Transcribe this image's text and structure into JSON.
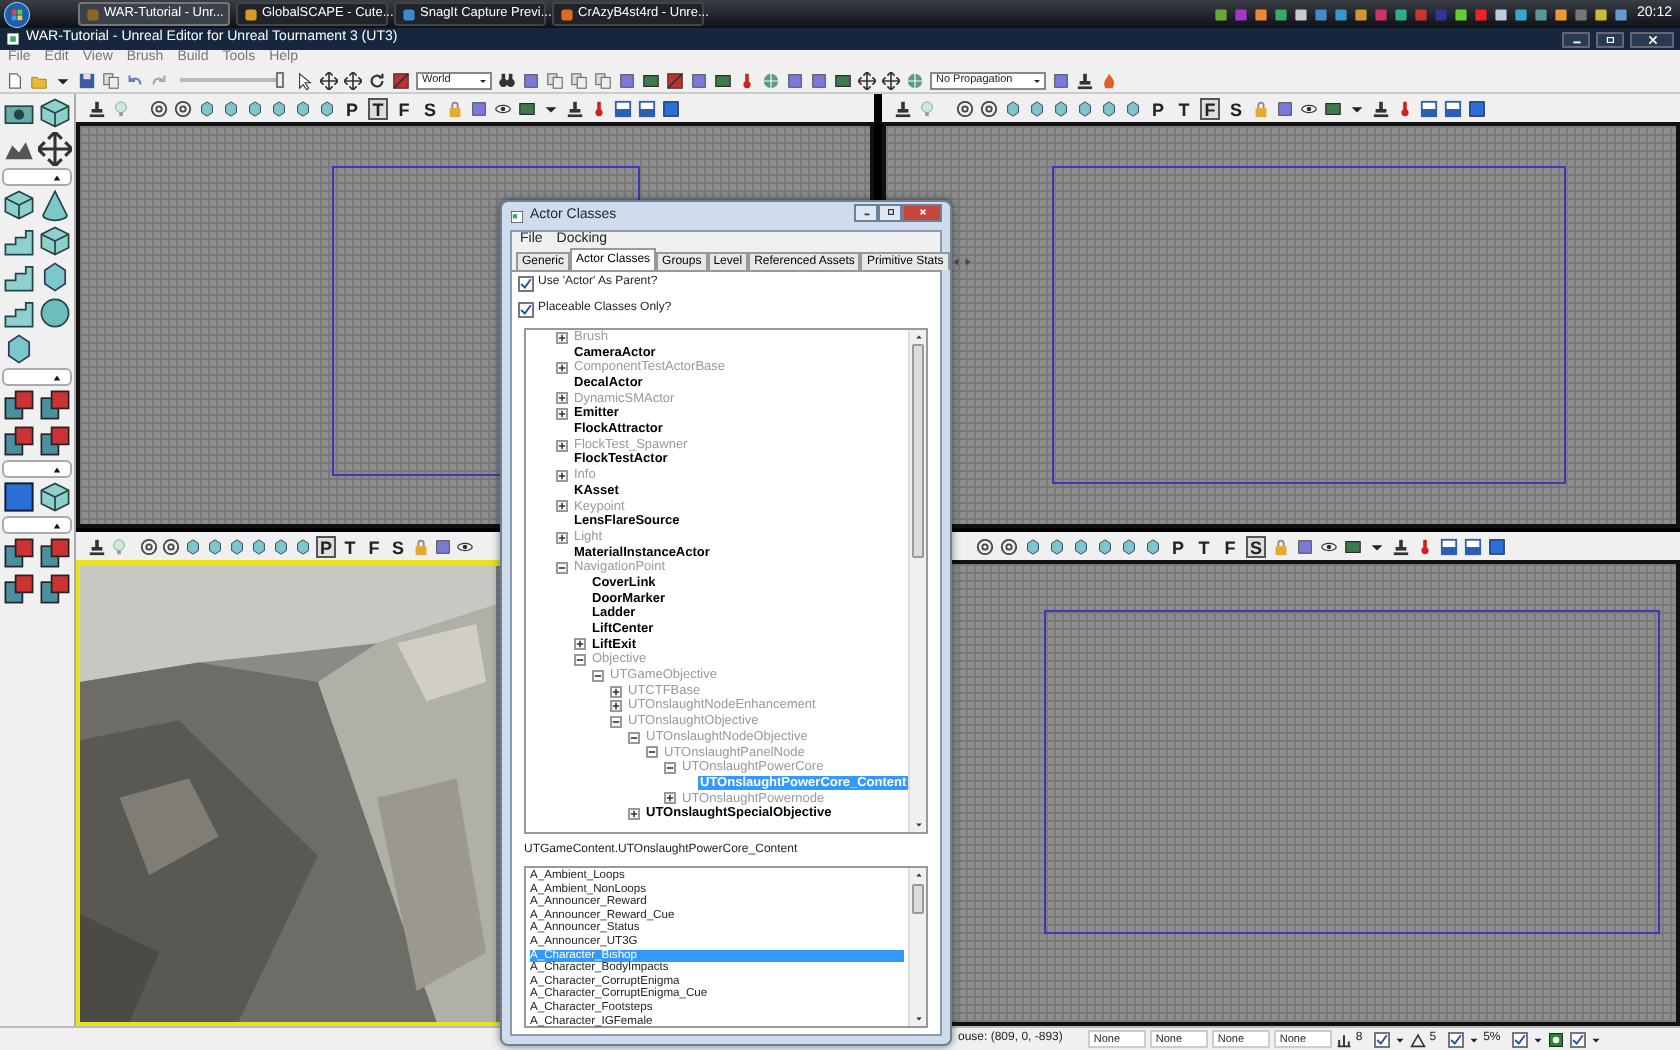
{
  "taskbar": {
    "tasks": [
      {
        "label": "WAR-Tutorial - Unr...",
        "selected": true
      },
      {
        "label": "GlobalSCAPE - Cute...",
        "selected": false
      },
      {
        "label": "SnagIt Capture Previ...",
        "selected": false
      },
      {
        "label": "CrAzyB4st4rd - Unre...",
        "selected": false
      }
    ],
    "clock": "20:12"
  },
  "window": {
    "title": "WAR-Tutorial - Unreal Editor for Unreal Tournament 3 (UT3)"
  },
  "menu": [
    "File",
    "Edit",
    "View",
    "Brush",
    "Build",
    "Tools",
    "Help"
  ],
  "toolbar": {
    "slider": {
      "level": 1
    },
    "world_combo": "World",
    "propagation_combo": "No Propagation"
  },
  "viewports": [
    {
      "kind": "grid",
      "active": false,
      "modes": [
        {
          "label": "P",
          "selected": false
        },
        {
          "label": "T",
          "selected": true
        },
        {
          "label": "F",
          "selected": false
        },
        {
          "label": "S",
          "selected": false
        }
      ]
    },
    {
      "kind": "grid",
      "active": false,
      "modes": [
        {
          "label": "P",
          "selected": false
        },
        {
          "label": "T",
          "selected": false
        },
        {
          "label": "F",
          "selected": true
        },
        {
          "label": "S",
          "selected": false
        }
      ]
    },
    {
      "kind": "perspective",
      "active": true,
      "modes": [
        {
          "label": "P",
          "selected": true
        },
        {
          "label": "T",
          "selected": false
        },
        {
          "label": "F",
          "selected": false
        },
        {
          "label": "S",
          "selected": false
        }
      ]
    },
    {
      "kind": "grid",
      "active": false,
      "modes": [
        {
          "label": "P",
          "selected": false
        },
        {
          "label": "T",
          "selected": false
        },
        {
          "label": "F",
          "selected": false
        },
        {
          "label": "S",
          "selected": true
        }
      ]
    }
  ],
  "dialog": {
    "title": "Actor Classes",
    "menu": [
      "File",
      "Docking"
    ],
    "tabs": [
      {
        "label": "Generic",
        "selected": false
      },
      {
        "label": "Actor Classes",
        "selected": true
      },
      {
        "label": "Groups",
        "selected": false
      },
      {
        "label": "Level",
        "selected": false
      },
      {
        "label": "Referenced Assets",
        "selected": false
      },
      {
        "label": "Primitive Stats",
        "selected": false
      }
    ],
    "options": [
      {
        "label": "Use 'Actor' As Parent?",
        "checked": true
      },
      {
        "label": "Placeable Classes Only?",
        "checked": true
      }
    ],
    "tree": [
      {
        "label": "Brush",
        "placeable": false,
        "expanded": false,
        "selected": false
      },
      {
        "label": "CameraActor",
        "placeable": true,
        "selected": false
      },
      {
        "label": "ComponentTestActorBase",
        "placeable": false,
        "expanded": false,
        "selected": false
      },
      {
        "label": "DecalActor",
        "placeable": true,
        "selected": false
      },
      {
        "label": "DynamicSMActor",
        "placeable": false,
        "expanded": false,
        "selected": false
      },
      {
        "label": "Emitter",
        "placeable": true,
        "expanded": false,
        "selected": false
      },
      {
        "label": "FlockAttractor",
        "placeable": true,
        "selected": false
      },
      {
        "label": "FlockTest_Spawner",
        "placeable": false,
        "expanded": false,
        "selected": false
      },
      {
        "label": "FlockTestActor",
        "placeable": true,
        "selected": false
      },
      {
        "label": "Info",
        "placeable": false,
        "expanded": false,
        "selected": false
      },
      {
        "label": "KAsset",
        "placeable": true,
        "selected": false
      },
      {
        "label": "Keypoint",
        "placeable": false,
        "expanded": false,
        "selected": false
      },
      {
        "label": "LensFlareSource",
        "placeable": true,
        "selected": false
      },
      {
        "label": "Light",
        "placeable": false,
        "expanded": false,
        "selected": false
      },
      {
        "label": "MaterialInstanceActor",
        "placeable": true,
        "selected": false
      },
      {
        "label": "NavigationPoint",
        "placeable": false,
        "expanded": true,
        "selected": false,
        "children": [
          {
            "label": "CoverLink",
            "placeable": true,
            "selected": false
          },
          {
            "label": "DoorMarker",
            "placeable": true,
            "selected": false
          },
          {
            "label": "Ladder",
            "placeable": true,
            "selected": false
          },
          {
            "label": "LiftCenter",
            "placeable": true,
            "selected": false
          },
          {
            "label": "LiftExit",
            "placeable": true,
            "expanded": false,
            "selected": false
          },
          {
            "label": "Objective",
            "placeable": false,
            "expanded": true,
            "selected": false,
            "children": [
              {
                "label": "UTGameObjective",
                "placeable": false,
                "expanded": true,
                "selected": false,
                "children": [
                  {
                    "label": "UTCTFBase",
                    "placeable": false,
                    "expanded": false,
                    "selected": false
                  },
                  {
                    "label": "UTOnslaughtNodeEnhancement",
                    "placeable": false,
                    "expanded": false,
                    "selected": false
                  },
                  {
                    "label": "UTOnslaughtObjective",
                    "placeable": false,
                    "expanded": true,
                    "selected": false,
                    "children": [
                      {
                        "label": "UTOnslaughtNodeObjective",
                        "placeable": false,
                        "expanded": true,
                        "selected": false,
                        "children": [
                          {
                            "label": "UTOnslaughtPanelNode",
                            "placeable": false,
                            "expanded": true,
                            "selected": false,
                            "children": [
                              {
                                "label": "UTOnslaughtPowerCore",
                                "placeable": false,
                                "expanded": true,
                                "selected": false,
                                "children": [
                                  {
                                    "label": "UTOnslaughtPowerCore_Content",
                                    "placeable": true,
                                    "selected": true
                                  }
                                ]
                              },
                              {
                                "label": "UTOnslaughtPowernode",
                                "placeable": false,
                                "expanded": false,
                                "selected": false
                              }
                            ]
                          }
                        ]
                      },
                      {
                        "label": "UTOnslaughtSpecialObjective",
                        "placeable": true,
                        "expanded": false,
                        "selected": false
                      }
                    ]
                  }
                ]
              }
            ]
          }
        ]
      }
    ],
    "path": "UTGameContent.UTOnslaughtPowerCore_Content",
    "packages": [
      {
        "label": "A_Ambient_Loops",
        "selected": false
      },
      {
        "label": "A_Ambient_NonLoops",
        "selected": false
      },
      {
        "label": "A_Announcer_Reward",
        "selected": false
      },
      {
        "label": "A_Announcer_Reward_Cue",
        "selected": false
      },
      {
        "label": "A_Announcer_Status",
        "selected": false
      },
      {
        "label": "A_Announcer_UT3G",
        "selected": false
      },
      {
        "label": "A_Character_Bishop",
        "selected": true
      },
      {
        "label": "A_Character_BodyImpacts",
        "selected": false
      },
      {
        "label": "A_Character_CorruptEnigma",
        "selected": false
      },
      {
        "label": "A_Character_CorruptEnigma_Cue",
        "selected": false
      },
      {
        "label": "A_Character_Footsteps",
        "selected": false
      },
      {
        "label": "A_Character_IGFemale",
        "selected": false
      }
    ]
  },
  "status_bar": {
    "mouse": "ouse: (809, 0, -893)",
    "fields": [
      "None",
      "None",
      "None",
      "None"
    ],
    "snaps": [
      {
        "kind": "grid",
        "value": "8",
        "checked": true
      },
      {
        "kind": "angle",
        "value": "5",
        "checked": true
      },
      {
        "kind": "scale",
        "value": "5%",
        "checked": true
      },
      {
        "kind": "vertex",
        "checked": true
      }
    ]
  }
}
